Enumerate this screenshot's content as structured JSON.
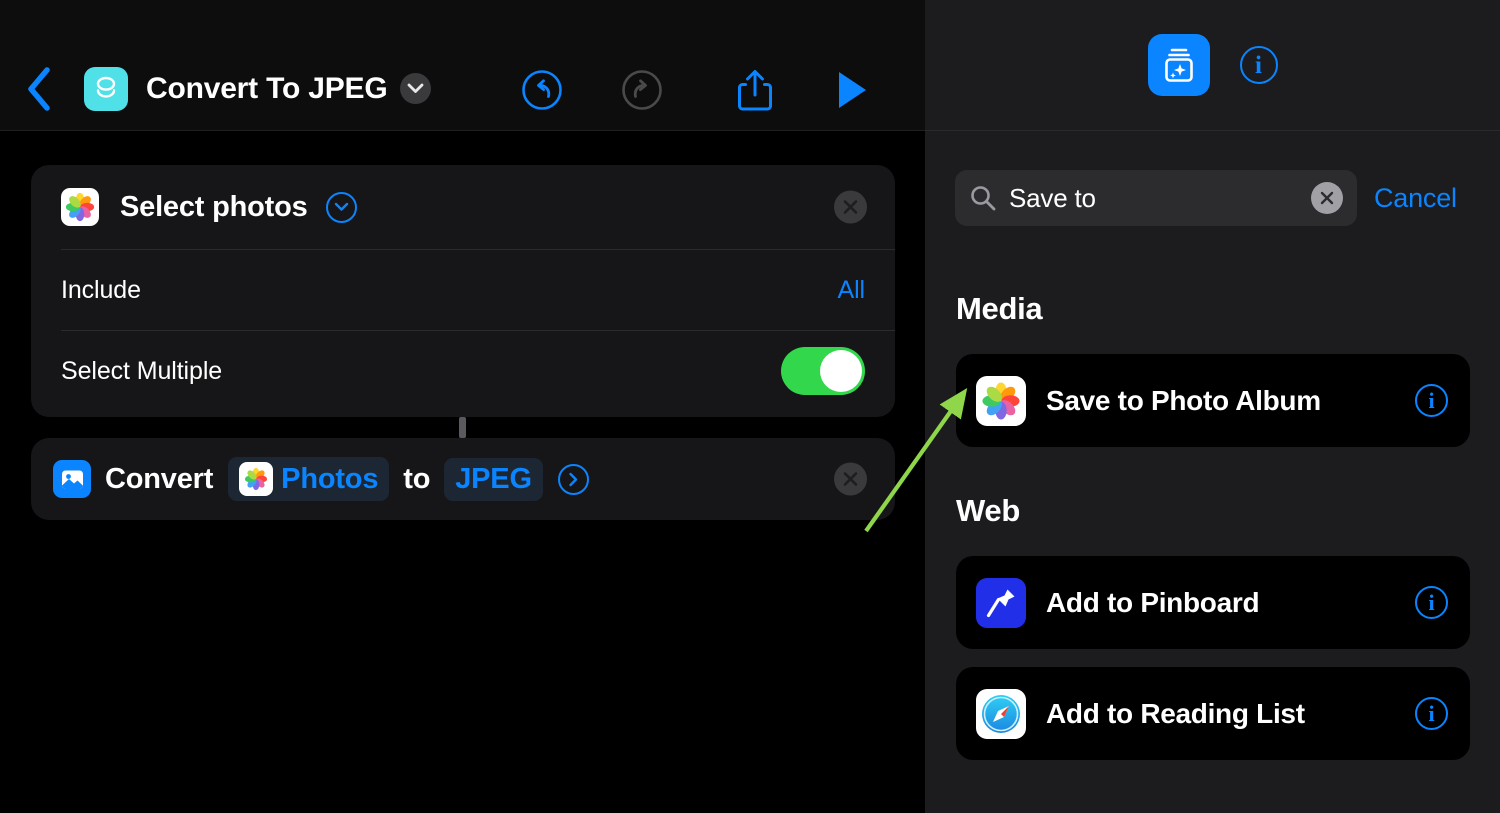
{
  "editor": {
    "back_icon": "chevron-left-icon",
    "shortcut_icon": "stacked-layers-icon",
    "title": "Convert To JPEG",
    "title_menu_icon": "chevron-down-icon",
    "toolbar": {
      "undo_icon": "undo-arrow-icon",
      "redo_icon": "redo-arrow-icon",
      "share_icon": "share-up-arrow-icon",
      "play_icon": "play-triangle-icon",
      "undo_enabled": true,
      "redo_enabled": false
    },
    "accent_blue": "#0a84ff",
    "shortcut_icon_color": "#4fe0e8",
    "actions": [
      {
        "icon": "photos-app-icon",
        "title": "Select photos",
        "expand_icon": "chevron-down-circle-icon",
        "remove_icon": "close-x-icon",
        "parameters": [
          {
            "label": "Include",
            "value": "All",
            "type": "value"
          },
          {
            "label": "Select Multiple",
            "value": "on",
            "type": "toggle"
          }
        ]
      },
      {
        "icon": "image-file-icon",
        "verb": "Convert",
        "source_token": "Photos",
        "source_token_icon": "photos-app-icon",
        "preposition": "to",
        "format_token": "JPEG",
        "detail_icon": "chevron-right-circle-icon",
        "remove_icon": "close-x-icon"
      }
    ]
  },
  "picker": {
    "gallery_icon": "actions-gallery-sparkle-icon",
    "info_icon": "info-circle-icon",
    "search": {
      "icon": "search-magnifier-icon",
      "value": "Save to",
      "clear_icon": "clear-x-circle-icon",
      "cancel_label": "Cancel"
    },
    "sections": [
      {
        "title": "Media",
        "items": [
          {
            "icon": "photos-app-icon",
            "label": "Save to Photo Album",
            "info_icon": "info-circle-icon"
          }
        ]
      },
      {
        "title": "Web",
        "items": [
          {
            "icon": "pinboard-pin-icon",
            "label": "Add to Pinboard",
            "info_icon": "info-circle-icon"
          },
          {
            "icon": "safari-compass-icon",
            "label": "Add to Reading List",
            "info_icon": "info-circle-icon"
          }
        ]
      }
    ]
  },
  "annotation": {
    "arrow_color": "#8fd64a",
    "description": "green-arrow-pointing-to-save-to-photo-album"
  }
}
